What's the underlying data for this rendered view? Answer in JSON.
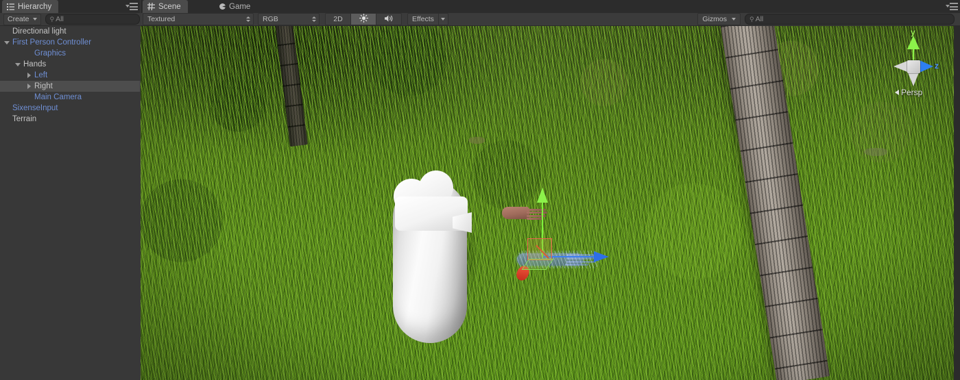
{
  "hierarchy_panel": {
    "tab_label": "Hierarchy",
    "tab_icon": "list-icon",
    "panel_menu_icon": "panel-options-icon",
    "create_button": "Create",
    "create_caret_icon": "chevron-down-icon",
    "search": {
      "icon": "search-icon",
      "placeholder": "All",
      "value": "All"
    },
    "items": [
      {
        "label": "Directional light",
        "indent": 0,
        "twisty": "none",
        "prefab": false,
        "selected": false
      },
      {
        "label": "First Person Controller",
        "indent": 0,
        "twisty": "down",
        "prefab": true,
        "selected": false
      },
      {
        "label": "Graphics",
        "indent": 2,
        "twisty": "none",
        "prefab": true,
        "selected": false
      },
      {
        "label": "Hands",
        "indent": 1,
        "twisty": "down",
        "prefab": false,
        "selected": false
      },
      {
        "label": "Left",
        "indent": 2,
        "twisty": "right",
        "prefab": true,
        "selected": false
      },
      {
        "label": "Right",
        "indent": 2,
        "twisty": "right",
        "prefab": false,
        "selected": true
      },
      {
        "label": "Main Camera",
        "indent": 2,
        "twisty": "none",
        "prefab": true,
        "selected": false
      },
      {
        "label": "SixenseInput",
        "indent": 0,
        "twisty": "none",
        "prefab": true,
        "selected": false
      },
      {
        "label": "Terrain",
        "indent": 0,
        "twisty": "none",
        "prefab": false,
        "selected": false
      }
    ]
  },
  "scene_panel": {
    "tabs": [
      {
        "label": "Scene",
        "icon": "grid-icon",
        "active": true
      },
      {
        "label": "Game",
        "icon": "gamepad-icon",
        "active": false
      }
    ],
    "panel_menu_icon": "panel-options-icon",
    "toolbar": {
      "draw_mode": "Textured",
      "draw_mode_icon": "updown-arrows-icon",
      "color_mode": "RGB",
      "color_mode_icon": "updown-arrows-icon",
      "toggle_2d": "2D",
      "lighting_icon": "sun-icon",
      "lighting_on": true,
      "audio_icon": "speaker-icon",
      "audio_on": false,
      "effects_label": "Effects",
      "effects_caret_icon": "chevron-down-icon",
      "gizmos_label": "Gizmos",
      "gizmos_caret_icon": "chevron-down-icon",
      "search": {
        "icon": "search-icon",
        "placeholder": "All",
        "value": "All"
      }
    },
    "viewport": {
      "orientation_gizmo": {
        "axis_y": "y",
        "axis_z": "z",
        "projection": "Persp",
        "projection_caret_icon": "chevron-left-icon",
        "color_y": "#8cf24a",
        "color_z": "#2e7ff0",
        "color_x": "#e8432e"
      },
      "transform_gizmo": {
        "type": "move",
        "color_x": "#e8432e",
        "color_y": "#8cf24a",
        "color_z": "#3c7ef3"
      },
      "objects": [
        {
          "name": "capsule-character",
          "label": "First Person Controller capsule"
        },
        {
          "name": "camera-gizmo",
          "label": "Main Camera gizmo"
        },
        {
          "name": "hand-model-left",
          "label": "Left hand mesh"
        },
        {
          "name": "hand-model-right-selected",
          "label": "Right hand mesh (selected)"
        },
        {
          "name": "palm-tree-right",
          "label": "Palm tree trunk"
        },
        {
          "name": "palm-tree-left",
          "label": "Background tree trunk"
        },
        {
          "name": "terrain-grass",
          "label": "Terrain with grass detail"
        }
      ]
    }
  }
}
